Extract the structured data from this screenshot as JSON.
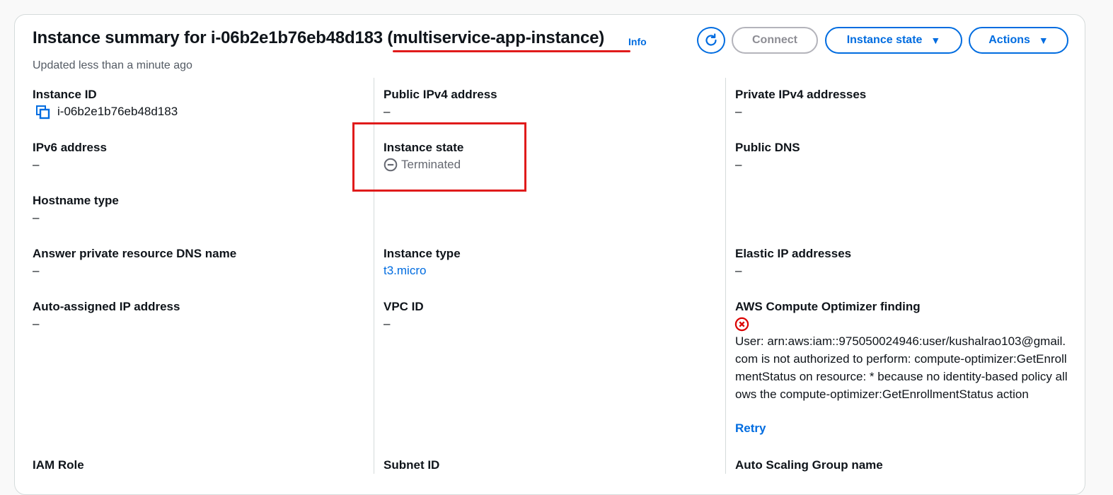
{
  "header": {
    "title": "Instance summary for i-06b2e1b76eb48d183 (multiservice-app-instance)",
    "info_link": "Info",
    "subtitle": "Updated less than a minute ago",
    "buttons": {
      "refresh_icon": "refresh-icon",
      "connect": "Connect",
      "instance_state": "Instance state",
      "actions": "Actions"
    }
  },
  "annotation_color": "#e01b1b",
  "accent_color": "#006ce0",
  "fields": {
    "instance_id": {
      "label": "Instance ID",
      "value": "i-06b2e1b76eb48d183"
    },
    "public_ipv4": {
      "label": "Public IPv4 address",
      "value": "–"
    },
    "private_ipv4": {
      "label": "Private IPv4 addresses",
      "value": "–"
    },
    "ipv6": {
      "label": "IPv6 address",
      "value": "–"
    },
    "instance_state": {
      "label": "Instance state",
      "value": "Terminated"
    },
    "public_dns": {
      "label": "Public DNS",
      "value": "–"
    },
    "hostname_type": {
      "label": "Hostname type",
      "value": "–"
    },
    "answer_dns": {
      "label": "Answer private resource DNS name",
      "value": "–"
    },
    "instance_type": {
      "label": "Instance type",
      "value": "t3.micro"
    },
    "elastic_ip": {
      "label": "Elastic IP addresses",
      "value": "–"
    },
    "auto_ip": {
      "label": "Auto-assigned IP address",
      "value": "–"
    },
    "vpc_id": {
      "label": "VPC ID",
      "value": "–"
    },
    "compute_optimizer": {
      "label": "AWS Compute Optimizer finding",
      "error": "User: arn:aws:iam::975050024946:user/kushalrao103@gmail.com is not authorized to perform: compute-optimizer:GetEnrollmentStatus on resource: * because no identity-based policy allows the compute-optimizer:GetEnrollmentStatus action",
      "retry": "Retry"
    },
    "iam_role": {
      "label": "IAM Role"
    },
    "subnet_id": {
      "label": "Subnet ID"
    },
    "asg_name": {
      "label": "Auto Scaling Group name"
    }
  }
}
